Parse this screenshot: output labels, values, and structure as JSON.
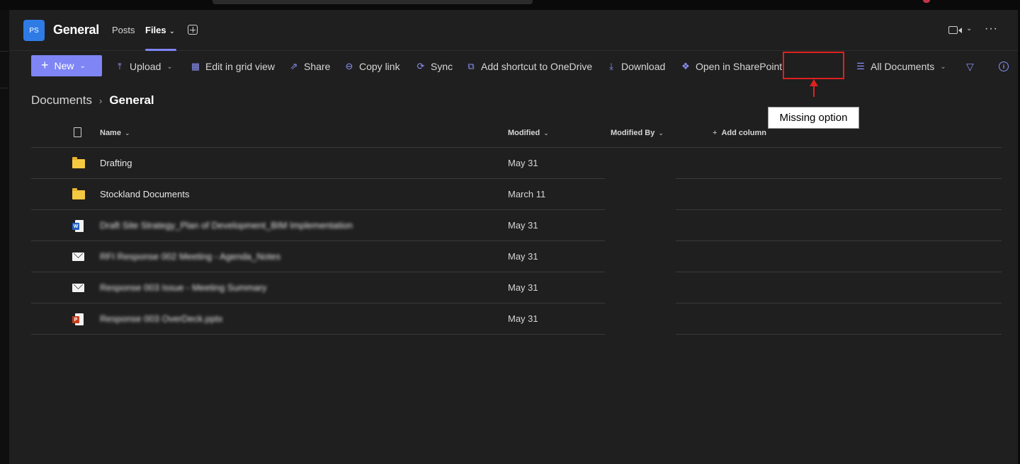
{
  "channel": {
    "avatar_initials": "PS",
    "name": "General",
    "tabs": [
      {
        "label": "Posts"
      },
      {
        "label": "Files",
        "selected": true
      }
    ]
  },
  "toolbar": {
    "new_label": "New",
    "upload_label": "Upload",
    "edit_grid_label": "Edit in grid view",
    "share_label": "Share",
    "copy_link_label": "Copy link",
    "sync_label": "Sync",
    "add_shortcut_label": "Add shortcut to OneDrive",
    "download_label": "Download",
    "open_sharepoint_label": "Open in SharePoint",
    "view_label": "All Documents"
  },
  "annotation": {
    "callout_text": "Missing option",
    "color": "#e02020"
  },
  "breadcrumb": {
    "root": "Documents",
    "current": "General"
  },
  "table": {
    "columns": {
      "name": "Name",
      "modified": "Modified",
      "modified_by": "Modified By",
      "add_column": "Add column"
    },
    "rows": [
      {
        "type": "folder",
        "name": "Drafting",
        "modified": "May 31",
        "blurred": false
      },
      {
        "type": "folder",
        "name": "Stockland Documents",
        "modified": "March 11",
        "blurred": false
      },
      {
        "type": "word",
        "name": "Draft Site Strategy_Plan of Development_BIM Implementation",
        "modified": "May 31",
        "blurred": true
      },
      {
        "type": "email",
        "name": "RFI Response 002 Meeting - Agenda_Notes",
        "modified": "May 31",
        "blurred": true
      },
      {
        "type": "email",
        "name": "Response 003 Issue - Meeting Summary",
        "modified": "May 31",
        "blurred": true
      },
      {
        "type": "powerpoint",
        "name": "Response 003 OverDeck.pptx",
        "modified": "May 31",
        "blurred": true
      }
    ]
  },
  "colors": {
    "accent": "#7f85f5",
    "background": "#1f1f1f",
    "avatar": "#2f7be6"
  }
}
